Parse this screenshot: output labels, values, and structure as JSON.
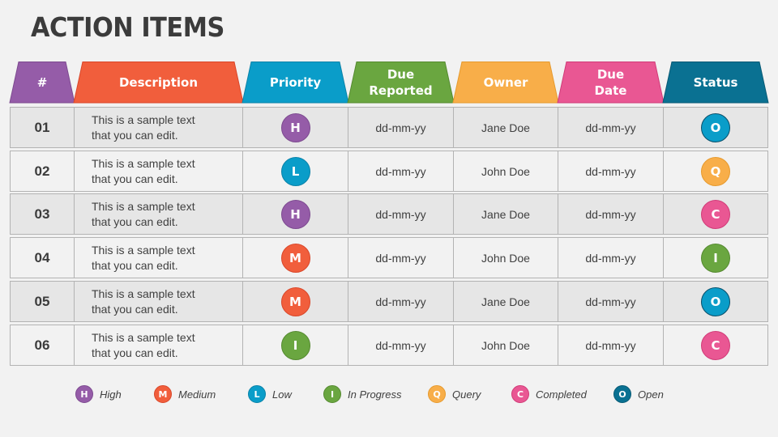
{
  "title": "ACTION ITEMS",
  "colors": {
    "purple": "#955ca8",
    "orange": "#f15e3c",
    "blue": "#0a9dc9",
    "green": "#6aa640",
    "amber": "#f8ae49",
    "pink": "#e95793",
    "teal": "#0a7192"
  },
  "headers": [
    {
      "label": "#",
      "color": "#955ca8",
      "border": "#7d4a90"
    },
    {
      "label": "Description",
      "color": "#f15e3c",
      "border": "#d9472a"
    },
    {
      "label": "Priority",
      "color": "#0a9dc9",
      "border": "#0a82a8"
    },
    {
      "label": "Due\nReported",
      "color": "#6aa640",
      "border": "#558a30"
    },
    {
      "label": "Owner",
      "color": "#f8ae49",
      "border": "#e69a2e"
    },
    {
      "label": "Due\nDate",
      "color": "#e95793",
      "border": "#d03c78"
    },
    {
      "label": "Status",
      "color": "#0a7192",
      "border": "#085a75"
    }
  ],
  "rows": [
    {
      "num": "01",
      "description": "This is a sample text\nthat you can edit.",
      "priority": "H",
      "due_reported": "dd-mm-yy",
      "owner": "Jane Doe",
      "due_date": "dd-mm-yy",
      "status": "O"
    },
    {
      "num": "02",
      "description": "This is a sample text\nthat you can edit.",
      "priority": "L",
      "due_reported": "dd-mm-yy",
      "owner": "John Doe",
      "due_date": "dd-mm-yy",
      "status": "Q"
    },
    {
      "num": "03",
      "description": "This is a sample text\nthat you can edit.",
      "priority": "H",
      "due_reported": "dd-mm-yy",
      "owner": "Jane Doe",
      "due_date": "dd-mm-yy",
      "status": "C"
    },
    {
      "num": "04",
      "description": "This is a sample text\nthat you can edit.",
      "priority": "M",
      "due_reported": "dd-mm-yy",
      "owner": "John Doe",
      "due_date": "dd-mm-yy",
      "status": "I"
    },
    {
      "num": "05",
      "description": "This is a sample text\nthat you can edit.",
      "priority": "M",
      "due_reported": "dd-mm-yy",
      "owner": "Jane Doe",
      "due_date": "dd-mm-yy",
      "status": "O"
    },
    {
      "num": "06",
      "description": "This is a sample text\nthat you can edit.",
      "priority": "I",
      "due_reported": "dd-mm-yy",
      "owner": "John Doe",
      "due_date": "dd-mm-yy",
      "status": "C"
    }
  ],
  "badge_styles": {
    "H": {
      "fill": "#955ca8",
      "border": "#7d4a90"
    },
    "M": {
      "fill": "#f15e3c",
      "border": "#d9472a"
    },
    "L": {
      "fill": "#0a9dc9",
      "border": "#0a82a8"
    },
    "I": {
      "fill": "#6aa640",
      "border": "#558a30"
    },
    "Q": {
      "fill": "#f8ae49",
      "border": "#e69a2e"
    },
    "C": {
      "fill": "#e95793",
      "border": "#d03c78"
    },
    "O": {
      "fill": "#0a9dc9",
      "border": "#0a4f6a"
    }
  },
  "legend": [
    {
      "letter": "H",
      "label": "High",
      "fill": "#955ca8",
      "border": "#7d4a90"
    },
    {
      "letter": "M",
      "label": "Medium",
      "fill": "#f15e3c",
      "border": "#d9472a"
    },
    {
      "letter": "L",
      "label": "Low",
      "fill": "#0a9dc9",
      "border": "#0a82a8"
    },
    {
      "letter": "I",
      "label": "In Progress",
      "fill": "#6aa640",
      "border": "#558a30"
    },
    {
      "letter": "Q",
      "label": "Query",
      "fill": "#f8ae49",
      "border": "#e69a2e"
    },
    {
      "letter": "C",
      "label": "Completed",
      "fill": "#e95793",
      "border": "#d03c78"
    },
    {
      "letter": "O",
      "label": "Open",
      "fill": "#0a7192",
      "border": "#085a75"
    }
  ]
}
